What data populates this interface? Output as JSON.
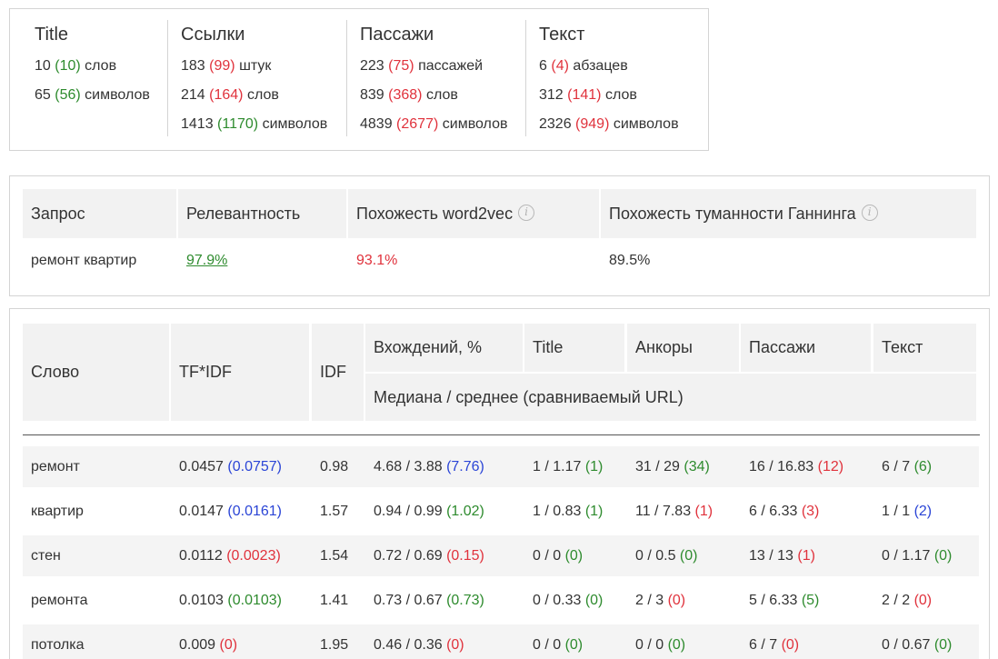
{
  "summary": {
    "title": {
      "heading": "Title",
      "rows": [
        {
          "main": "10",
          "paren": "(10)",
          "paren_color": "g",
          "unit": "слов"
        },
        {
          "main": "65",
          "paren": "(56)",
          "paren_color": "g",
          "unit": "символов"
        }
      ]
    },
    "links": {
      "heading": "Ссылки",
      "rows": [
        {
          "main": "183",
          "paren": "(99)",
          "paren_color": "r",
          "unit": "штук"
        },
        {
          "main": "214",
          "paren": "(164)",
          "paren_color": "r",
          "unit": "слов"
        },
        {
          "main": "1413",
          "paren": "(1170)",
          "paren_color": "g",
          "unit": "символов"
        }
      ]
    },
    "passages": {
      "heading": "Пассажи",
      "rows": [
        {
          "main": "223",
          "paren": "(75)",
          "paren_color": "r",
          "unit": "пассажей"
        },
        {
          "main": "839",
          "paren": "(368)",
          "paren_color": "r",
          "unit": "слов"
        },
        {
          "main": "4839",
          "paren": "(2677)",
          "paren_color": "r",
          "unit": "символов"
        }
      ]
    },
    "text": {
      "heading": "Текст",
      "rows": [
        {
          "main": "6",
          "paren": "(4)",
          "paren_color": "r",
          "unit": "абзацев"
        },
        {
          "main": "312",
          "paren": "(141)",
          "paren_color": "r",
          "unit": "слов"
        },
        {
          "main": "2326",
          "paren": "(949)",
          "paren_color": "r",
          "unit": "символов"
        }
      ]
    }
  },
  "query": {
    "headers": {
      "query": "Запрос",
      "relevance": "Релевантность",
      "w2v": "Похожесть word2vec",
      "gunning": "Похожесть туманности Ганнинга"
    },
    "info_glyph": "i",
    "row": {
      "query": "ремонт квартир",
      "relevance": "97.9%",
      "w2v": "93.1%",
      "gunning": "89.5%"
    }
  },
  "words": {
    "headers": {
      "word": "Слово",
      "tfidf": "TF*IDF",
      "idf": "IDF",
      "occurrences": "Вхождений, %",
      "title": "Title",
      "anchors": "Анкоры",
      "passages": "Пассажи",
      "text": "Текст",
      "subheader": "Медиана / среднее (сравниваемый URL)"
    },
    "rows": [
      {
        "word": "ремонт",
        "tfidf": {
          "main": "0.0457 ",
          "paren": "(0.0757)",
          "c": "b"
        },
        "idf": "0.98",
        "occ": {
          "main": "4.68 / 3.88 ",
          "paren": "(7.76)",
          "c": "b"
        },
        "title": {
          "main": "1 / 1.17 ",
          "paren": "(1)",
          "c": "g"
        },
        "anchors": {
          "main": "31 / 29 ",
          "paren": "(34)",
          "c": "g"
        },
        "passages": {
          "main": "16 / 16.83 ",
          "paren": "(12)",
          "c": "r"
        },
        "text": {
          "main": "6 / 7 ",
          "paren": "(6)",
          "c": "g"
        }
      },
      {
        "word": "квартир",
        "tfidf": {
          "main": "0.0147 ",
          "paren": "(0.0161)",
          "c": "b"
        },
        "idf": "1.57",
        "occ": {
          "main": "0.94 / 0.99 ",
          "paren": "(1.02)",
          "c": "g"
        },
        "title": {
          "main": "1 / 0.83 ",
          "paren": "(1)",
          "c": "g"
        },
        "anchors": {
          "main": "11 / 7.83 ",
          "paren": "(1)",
          "c": "r"
        },
        "passages": {
          "main": "6 / 6.33 ",
          "paren": "(3)",
          "c": "r"
        },
        "text": {
          "main": "1 / 1 ",
          "paren": "(2)",
          "c": "b"
        }
      },
      {
        "word": "стен",
        "tfidf": {
          "main": "0.0112 ",
          "paren": "(0.0023)",
          "c": "r"
        },
        "idf": "1.54",
        "occ": {
          "main": "0.72 / 0.69 ",
          "paren": "(0.15)",
          "c": "r"
        },
        "title": {
          "main": "0 / 0 ",
          "paren": "(0)",
          "c": "g"
        },
        "anchors": {
          "main": "0 / 0.5 ",
          "paren": "(0)",
          "c": "g"
        },
        "passages": {
          "main": "13 / 13 ",
          "paren": "(1)",
          "c": "r"
        },
        "text": {
          "main": "0 / 1.17 ",
          "paren": "(0)",
          "c": "g"
        }
      },
      {
        "word": "ремонта",
        "tfidf": {
          "main": "0.0103 ",
          "paren": "(0.0103)",
          "c": "g"
        },
        "idf": "1.41",
        "occ": {
          "main": "0.73 / 0.67 ",
          "paren": "(0.73)",
          "c": "g"
        },
        "title": {
          "main": "0 / 0.33 ",
          "paren": "(0)",
          "c": "g"
        },
        "anchors": {
          "main": "2 / 3 ",
          "paren": "(0)",
          "c": "r"
        },
        "passages": {
          "main": "5 / 6.33 ",
          "paren": "(5)",
          "c": "g"
        },
        "text": {
          "main": "2 / 2 ",
          "paren": "(0)",
          "c": "r"
        }
      },
      {
        "word": "потолка",
        "tfidf": {
          "main": "0.009 ",
          "paren": "(0)",
          "c": "r"
        },
        "idf": "1.95",
        "occ": {
          "main": "0.46 / 0.36 ",
          "paren": "(0)",
          "c": "r"
        },
        "title": {
          "main": "0 / 0 ",
          "paren": "(0)",
          "c": "g"
        },
        "anchors": {
          "main": "0 / 0 ",
          "paren": "(0)",
          "c": "g"
        },
        "passages": {
          "main": "6 / 7 ",
          "paren": "(0)",
          "c": "r"
        },
        "text": {
          "main": "0 / 0.67 ",
          "paren": "(0)",
          "c": "g"
        }
      }
    ]
  }
}
